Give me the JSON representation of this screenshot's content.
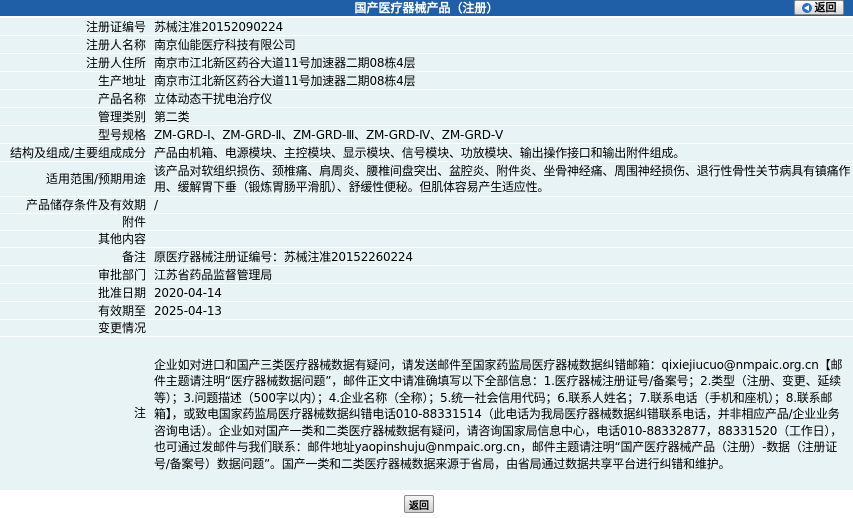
{
  "header": {
    "title": "国产医疗器械产品（注册）",
    "back_label": "返回"
  },
  "fields": [
    {
      "label": "注册证编号",
      "value": "苏械注准20152090224"
    },
    {
      "label": "注册人名称",
      "value": "南京仙能医疗科技有限公司"
    },
    {
      "label": "注册人住所",
      "value": "南京市江北新区药谷大道11号加速器二期08栋4层"
    },
    {
      "label": "生产地址",
      "value": "南京市江北新区药谷大道11号加速器二期08栋4层"
    },
    {
      "label": "产品名称",
      "value": "立体动态干扰电治疗仪"
    },
    {
      "label": "管理类别",
      "value": "第二类"
    },
    {
      "label": "型号规格",
      "value": "ZM-GRD-Ⅰ、ZM-GRD-Ⅱ、ZM-GRD-Ⅲ、ZM-GRD-Ⅳ、ZM-GRD-Ⅴ"
    },
    {
      "label": "结构及组成/主要组成成分",
      "value": "产品由机箱、电源模块、主控模块、显示模块、信号模块、功放模块、输出操作接口和输出附件组成。"
    },
    {
      "label": "适用范围/预期用途",
      "value": "该产品对软组织损伤、颈椎痛、肩周炎、腰椎间盘突出、盆腔炎、附件炎、坐骨神经痛、周围神经损伤、退行性骨性关节病具有镇痛作用、缓解胃下垂（锻炼胃肠平滑肌）、舒缓性便秘。但肌体容易产生适应性。"
    },
    {
      "label": "产品储存条件及有效期",
      "value": "/"
    },
    {
      "label": "附件",
      "value": ""
    },
    {
      "label": "其他内容",
      "value": ""
    },
    {
      "label": "备注",
      "value": "原医疗器械注册证编号：苏械注准20152260224"
    },
    {
      "label": "审批部门",
      "value": "江苏省药品监督管理局"
    },
    {
      "label": "批准日期",
      "value": "2020-04-14"
    },
    {
      "label": "有效期至",
      "value": "2025-04-13"
    },
    {
      "label": "变更情况",
      "value": ""
    },
    {
      "label": "注",
      "value": "企业如对进口和国产三类医疗器械数据有疑问，请发送邮件至国家药监局医疗器械数据纠错邮箱：qixiejiucuo@nmpaic.org.cn【邮件主题请注明“医疗器械数据问题”，邮件正文中请准确填写以下全部信息：1.医疗器械注册证号/备案号；2.类型（注册、变更、延续等）；3.问题描述（500字以内）；4.企业名称（全称）；5.统一社会信用代码；6.联系人姓名；7.联系电话（手机和座机）；8.联系邮箱】，或致电国家药监局医疗器械数据纠错电话010-88331514（此电话为我局医疗器械数据纠错联系电话，并非相应产品/企业业务咨询电话）。企业如对国产一类和二类医疗器械数据有疑问，请咨询国家局信息中心，电话010-88332877，88331520（工作日），也可通过发邮件与我们联系：邮件地址yaopinshuju@nmpaic.org.cn，邮件主题请注明“国产医疗器械产品（注册）-数据（注册证号/备案号）数据问题”。国产一类和二类医疗器械数据来源于省局，由省局通过数据共享平台进行纠错和维护。"
    }
  ],
  "footer": {
    "back_label": "返回"
  }
}
